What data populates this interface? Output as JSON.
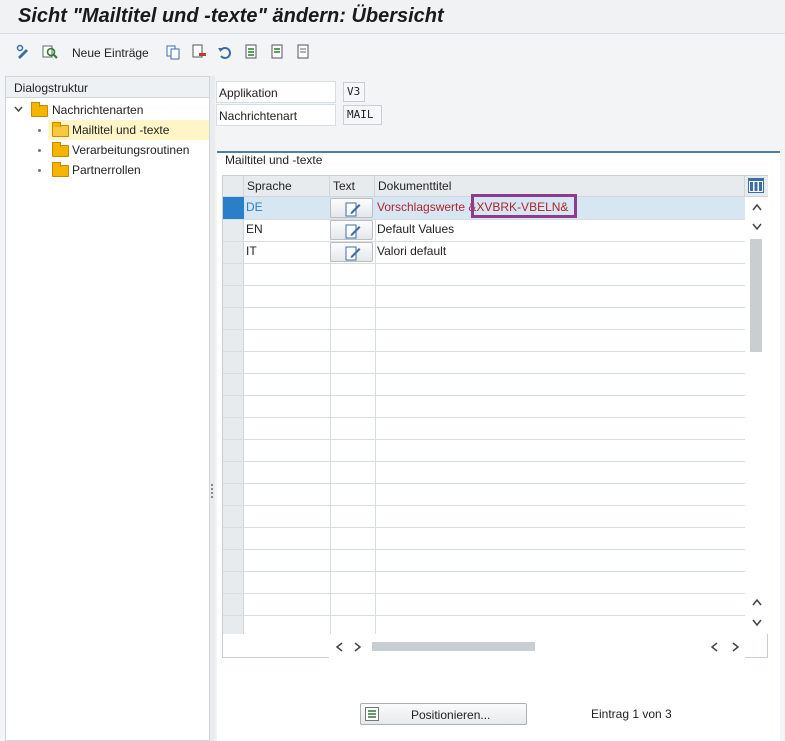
{
  "window": {
    "title": "Sicht \"Mailtitel und -texte\" ändern: Übersicht"
  },
  "toolbar": {
    "new_entries_label": "Neue Einträge"
  },
  "dialog_structure": {
    "header": "Dialogstruktur",
    "root": "Nachrichtenarten",
    "items": [
      "Mailtitel und -texte",
      "Verarbeitungsroutinen",
      "Partnerrollen"
    ]
  },
  "fields": {
    "application_label": "Applikation",
    "application_value": "V3",
    "message_type_label": "Nachrichtenart",
    "message_type_value": "MAIL"
  },
  "group": {
    "title": "Mailtitel und -texte"
  },
  "table": {
    "columns": [
      "Sprache",
      "Text",
      "Dokumenttitel"
    ],
    "rows": [
      {
        "language": "DE",
        "title": "Vorschlagswerte &XVBRK-VBELN&"
      },
      {
        "language": "EN",
        "title": "Default Values"
      },
      {
        "language": "IT",
        "title": "Valori default"
      }
    ]
  },
  "footer": {
    "position_button": "Positionieren...",
    "entry_status": "Eintrag 1 von 3"
  },
  "colors": {
    "accent": "#4e7fa3",
    "selected_row": "#d6e6f3",
    "red_text": "#b0232a",
    "highlight": "#8e3b8e"
  }
}
